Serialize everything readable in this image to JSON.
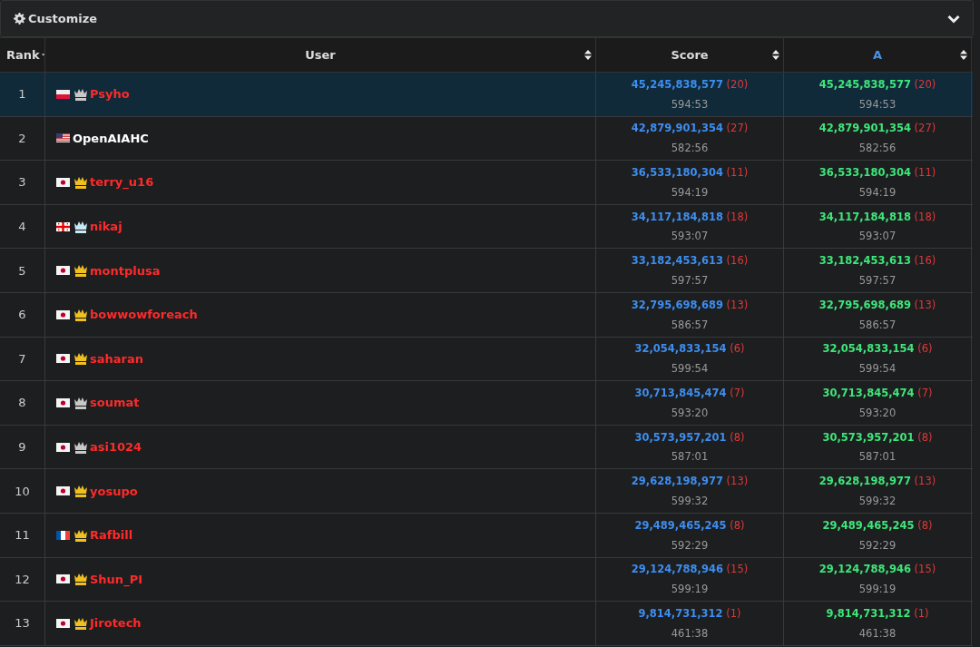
{
  "panel": {
    "title": "Customize"
  },
  "table": {
    "columns": [
      {
        "label": "Rank",
        "kind": "sorted"
      },
      {
        "label": "User",
        "kind": "sortable"
      },
      {
        "label": "Score",
        "kind": "sortable"
      },
      {
        "label": "A",
        "kind": "task"
      }
    ],
    "rows": [
      {
        "rank": "1",
        "selected": true,
        "flag": {
          "kind": "pl"
        },
        "badge": {
          "color": "#c8c8c8"
        },
        "user": {
          "name": "Psyho",
          "color": "#ff2a2a"
        },
        "score": "45,245,838,577",
        "score_count": "(20)",
        "score_time": "594:53",
        "a": "45,245,838,577",
        "a_count": "(20)",
        "a_time": "594:53"
      },
      {
        "rank": "2",
        "selected": false,
        "flag": {
          "kind": "us"
        },
        "user": {
          "name": "OpenAIAHC",
          "color": "#ffffff"
        },
        "score": "42,879,901,354",
        "score_count": "(27)",
        "score_time": "582:56",
        "a": "42,879,901,354",
        "a_count": "(27)",
        "a_time": "582:56"
      },
      {
        "rank": "3",
        "selected": false,
        "flag": {
          "kind": "jp"
        },
        "badge": {
          "color": "#f0c020"
        },
        "user": {
          "name": "terry_u16",
          "color": "#ff2a2a"
        },
        "score": "36,533,180,304",
        "score_count": "(11)",
        "score_time": "594:19",
        "a": "36,533,180,304",
        "a_count": "(11)",
        "a_time": "594:19"
      },
      {
        "rank": "4",
        "selected": false,
        "flag": {
          "kind": "ge"
        },
        "badge": {
          "color": "#c8eaf5"
        },
        "user": {
          "name": "nikaj",
          "color": "#ff2a2a"
        },
        "score": "34,117,184,818",
        "score_count": "(18)",
        "score_time": "593:07",
        "a": "34,117,184,818",
        "a_count": "(18)",
        "a_time": "593:07"
      },
      {
        "rank": "5",
        "selected": false,
        "flag": {
          "kind": "jp"
        },
        "badge": {
          "color": "#f0c020"
        },
        "user": {
          "name": "montplusa",
          "color": "#ff2a2a"
        },
        "score": "33,182,453,613",
        "score_count": "(16)",
        "score_time": "597:57",
        "a": "33,182,453,613",
        "a_count": "(16)",
        "a_time": "597:57"
      },
      {
        "rank": "6",
        "selected": false,
        "flag": {
          "kind": "jp"
        },
        "badge": {
          "color": "#f0c020"
        },
        "user": {
          "name": "bowwowforeach",
          "color": "#ff2a2a"
        },
        "score": "32,795,698,689",
        "score_count": "(13)",
        "score_time": "586:57",
        "a": "32,795,698,689",
        "a_count": "(13)",
        "a_time": "586:57"
      },
      {
        "rank": "7",
        "selected": false,
        "flag": {
          "kind": "jp"
        },
        "badge": {
          "color": "#f0c020"
        },
        "user": {
          "name": "saharan",
          "color": "#ff2a2a"
        },
        "score": "32,054,833,154",
        "score_count": "(6)",
        "score_time": "599:54",
        "a": "32,054,833,154",
        "a_count": "(6)",
        "a_time": "599:54"
      },
      {
        "rank": "8",
        "selected": false,
        "flag": {
          "kind": "jp"
        },
        "badge": {
          "color": "#c8c8c8"
        },
        "user": {
          "name": "soumat",
          "color": "#ff2a2a"
        },
        "score": "30,713,845,474",
        "score_count": "(7)",
        "score_time": "593:20",
        "a": "30,713,845,474",
        "a_count": "(7)",
        "a_time": "593:20"
      },
      {
        "rank": "9",
        "selected": false,
        "flag": {
          "kind": "jp"
        },
        "badge": {
          "color": "#c8c8c8"
        },
        "user": {
          "name": "asi1024",
          "color": "#ff2a2a"
        },
        "score": "30,573,957,201",
        "score_count": "(8)",
        "score_time": "587:01",
        "a": "30,573,957,201",
        "a_count": "(8)",
        "a_time": "587:01"
      },
      {
        "rank": "10",
        "selected": false,
        "flag": {
          "kind": "jp"
        },
        "badge": {
          "color": "#f0c020"
        },
        "user": {
          "name": "yosupo",
          "color": "#ff2a2a"
        },
        "score": "29,628,198,977",
        "score_count": "(13)",
        "score_time": "599:32",
        "a": "29,628,198,977",
        "a_count": "(13)",
        "a_time": "599:32"
      },
      {
        "rank": "11",
        "selected": false,
        "flag": {
          "kind": "fr"
        },
        "badge": {
          "color": "#f0c020"
        },
        "user": {
          "name": "Rafbill",
          "color": "#ff2a2a"
        },
        "score": "29,489,465,245",
        "score_count": "(8)",
        "score_time": "592:29",
        "a": "29,489,465,245",
        "a_count": "(8)",
        "a_time": "592:29"
      },
      {
        "rank": "12",
        "selected": false,
        "flag": {
          "kind": "jp"
        },
        "badge": {
          "color": "#f0c020"
        },
        "user": {
          "name": "Shun_PI",
          "color": "#ff2a2a"
        },
        "score": "29,124,788,946",
        "score_count": "(15)",
        "score_time": "599:19",
        "a": "29,124,788,946",
        "a_count": "(15)",
        "a_time": "599:19"
      },
      {
        "rank": "13",
        "selected": false,
        "flag": {
          "kind": "jp"
        },
        "badge": {
          "color": "#f0c020"
        },
        "user": {
          "name": "Jirotech",
          "color": "#ff2a2a"
        },
        "score": "9,814,731,312",
        "score_count": "(1)",
        "score_time": "461:38",
        "a": "9,814,731,312",
        "a_count": "(1)",
        "a_time": "461:38"
      }
    ]
  }
}
